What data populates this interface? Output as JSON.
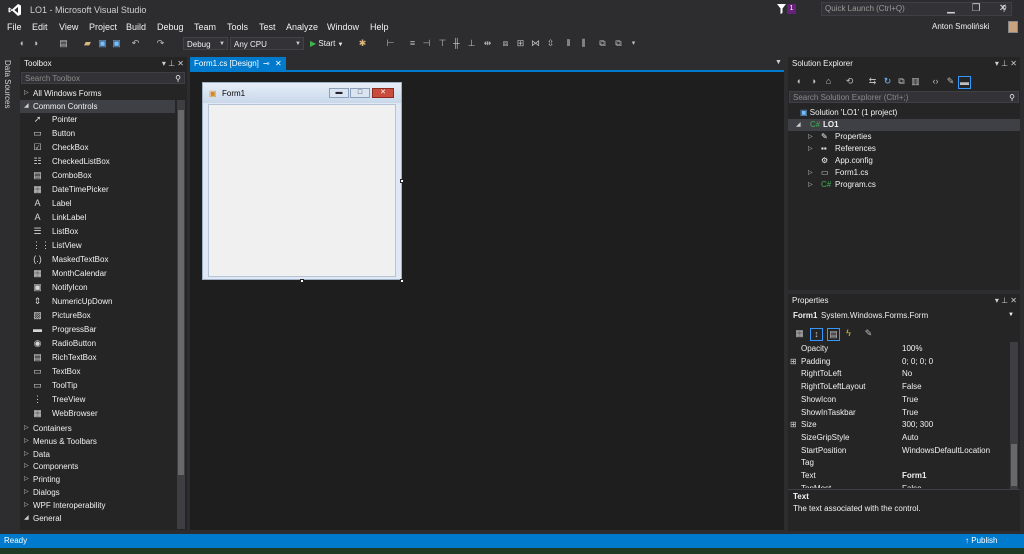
{
  "window": {
    "title": "LO1 - Microsoft Visual Studio",
    "quick_launch_placeholder": "Quick Launch (Ctrl+Q)",
    "notifications_count": "1",
    "user": "Anton Smoliński"
  },
  "menu": [
    "File",
    "Edit",
    "View",
    "Project",
    "Build",
    "Debug",
    "Team",
    "Tools",
    "Test",
    "Analyze",
    "Window",
    "Help"
  ],
  "toolbar": {
    "config": "Debug",
    "platform": "Any CPU",
    "start_label": "Start"
  },
  "side_strip": {
    "label": "Data Sources"
  },
  "toolbox": {
    "title": "Toolbox",
    "search_placeholder": "Search Toolbox",
    "group_all": "All Windows Forms",
    "group_common": "Common Controls",
    "items": [
      {
        "label": "Pointer",
        "icon": "pointer-icon"
      },
      {
        "label": "Button",
        "icon": "button-icon"
      },
      {
        "label": "CheckBox",
        "icon": "checkbox-icon"
      },
      {
        "label": "CheckedListBox",
        "icon": "checkedlistbox-icon"
      },
      {
        "label": "ComboBox",
        "icon": "combobox-icon"
      },
      {
        "label": "DateTimePicker",
        "icon": "datetimepicker-icon"
      },
      {
        "label": "Label",
        "icon": "label-icon"
      },
      {
        "label": "LinkLabel",
        "icon": "linklabel-icon"
      },
      {
        "label": "ListBox",
        "icon": "listbox-icon"
      },
      {
        "label": "ListView",
        "icon": "listview-icon"
      },
      {
        "label": "MaskedTextBox",
        "icon": "maskedtextbox-icon"
      },
      {
        "label": "MonthCalendar",
        "icon": "monthcalendar-icon"
      },
      {
        "label": "NotifyIcon",
        "icon": "notifyicon-icon"
      },
      {
        "label": "NumericUpDown",
        "icon": "numericupdown-icon"
      },
      {
        "label": "PictureBox",
        "icon": "picturebox-icon"
      },
      {
        "label": "ProgressBar",
        "icon": "progressbar-icon"
      },
      {
        "label": "RadioButton",
        "icon": "radiobutton-icon"
      },
      {
        "label": "RichTextBox",
        "icon": "richtextbox-icon"
      },
      {
        "label": "TextBox",
        "icon": "textbox-icon"
      },
      {
        "label": "ToolTip",
        "icon": "tooltip-icon"
      },
      {
        "label": "TreeView",
        "icon": "treeview-icon"
      },
      {
        "label": "WebBrowser",
        "icon": "webbrowser-icon"
      }
    ],
    "groups": [
      "Containers",
      "Menus & Toolbars",
      "Data",
      "Components",
      "Printing",
      "Dialogs",
      "WPF Interoperability",
      "General"
    ]
  },
  "editor": {
    "tab_label": "Form1.cs [Design]",
    "form_title": "Form1"
  },
  "solution_explorer": {
    "title": "Solution Explorer",
    "search_placeholder": "Search Solution Explorer (Ctrl+;)",
    "solution": "Solution 'LO1' (1 project)",
    "project": "LO1",
    "items": [
      "Properties",
      "References",
      "App.config",
      "Form1.cs",
      "Program.cs"
    ]
  },
  "properties": {
    "title": "Properties",
    "object": "Form1",
    "object_type": "System.Windows.Forms.Form",
    "rows": [
      {
        "name": "Opacity",
        "value": "100%",
        "expandable": false
      },
      {
        "name": "Padding",
        "value": "0; 0; 0; 0",
        "expandable": true
      },
      {
        "name": "RightToLeft",
        "value": "No",
        "expandable": false
      },
      {
        "name": "RightToLeftLayout",
        "value": "False",
        "expandable": false
      },
      {
        "name": "ShowIcon",
        "value": "True",
        "expandable": false
      },
      {
        "name": "ShowInTaskbar",
        "value": "True",
        "expandable": false
      },
      {
        "name": "Size",
        "value": "300; 300",
        "expandable": true
      },
      {
        "name": "SizeGripStyle",
        "value": "Auto",
        "expandable": false
      },
      {
        "name": "StartPosition",
        "value": "WindowsDefaultLocation",
        "expandable": false
      },
      {
        "name": "Tag",
        "value": "",
        "expandable": false
      },
      {
        "name": "Text",
        "value": "Form1",
        "expandable": false
      },
      {
        "name": "TopMost",
        "value": "False",
        "expandable": false
      }
    ],
    "desc_title": "Text",
    "desc_text": "The text associated with the control."
  },
  "status": {
    "text": "Ready",
    "publish": "Publish"
  },
  "colors": {
    "accent": "#007acc",
    "background": "#2d2d30",
    "panel": "#252526",
    "editor": "#1e1e1e"
  }
}
